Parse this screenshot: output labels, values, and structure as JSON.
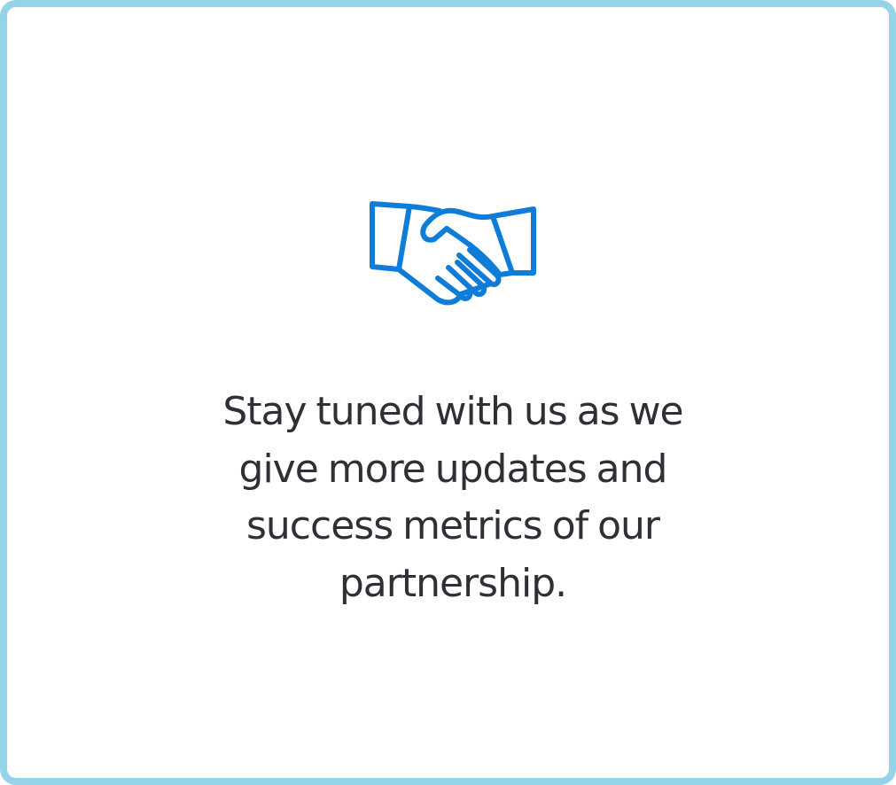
{
  "card": {
    "message": "Stay tuned with us as we give more updates and success metrics of our partnership.",
    "icon": "handshake-icon"
  },
  "colors": {
    "border": "#95d3e8",
    "icon": "#0f7dd8",
    "text": "#2f3036"
  }
}
